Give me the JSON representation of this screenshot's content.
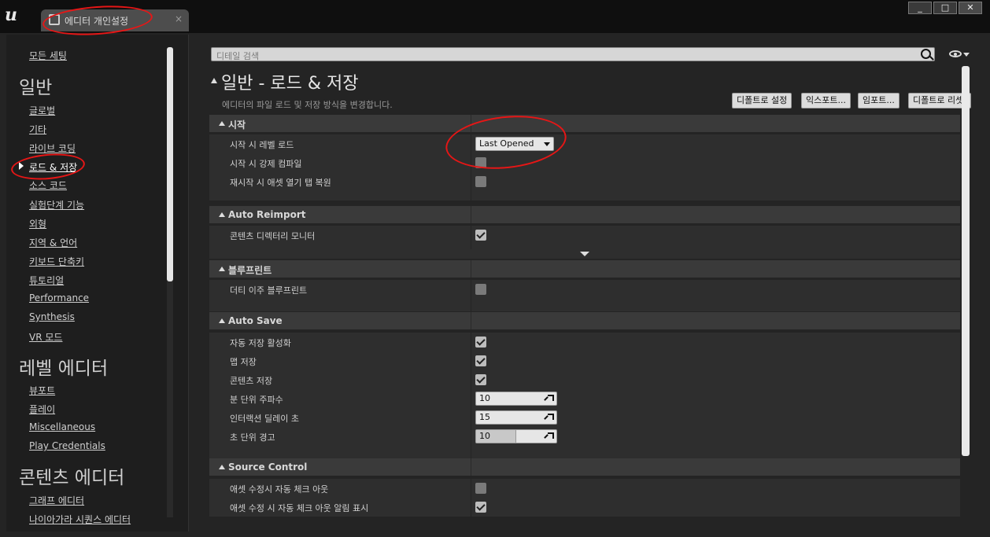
{
  "window": {
    "tab_title": "에디터 개인설정",
    "tab_close": "×",
    "logo": "u",
    "buttons": [
      "_",
      "□",
      "✕"
    ]
  },
  "sidebar": {
    "top_item": "모든 세팅",
    "sections": [
      {
        "title": "일반",
        "items": [
          "글로벌",
          "기타",
          "라이브 코딩",
          "로드 & 저장",
          "소스 코드",
          "실험단계 기능",
          "외형",
          "지역 & 언어",
          "키보드 단축키",
          "튜토리얼",
          "Performance",
          "Synthesis",
          "VR 모드"
        ]
      },
      {
        "title": "레벨 에디터",
        "items": [
          "뷰포트",
          "플레이",
          "Miscellaneous",
          "Play Credentials"
        ]
      },
      {
        "title": "콘텐츠 에디터",
        "items": [
          "그래프 에디터",
          "나이아가라 시퀀스 에디터"
        ]
      }
    ],
    "active_item": "로드 & 저장"
  },
  "search": {
    "placeholder": "디테일 검색"
  },
  "page": {
    "title": "일반 - 로드 & 저장",
    "description": "에디터의 파일 로드 및 저장 방식을 변경합니다.",
    "buttons": [
      "디폴트로 설정",
      "익스포트...",
      "임포트...",
      "디폴트로 리셋"
    ]
  },
  "categories": {
    "startup": {
      "label": "시작",
      "rows": [
        {
          "label": "시작 시 레벨 로드",
          "type": "dropdown",
          "value": "Last Opened"
        },
        {
          "label": "시작 시 강제 컴파일",
          "type": "checkbox",
          "checked": false
        },
        {
          "label": "재시작 시 애셋 열기 탭 복원",
          "type": "checkbox",
          "checked": false
        }
      ]
    },
    "auto_reimport": {
      "label": "Auto Reimport",
      "rows": [
        {
          "label": "콘텐츠 디렉터리 모니터",
          "type": "checkbox",
          "checked": true
        }
      ]
    },
    "blueprint": {
      "label": "블루프린트",
      "rows": [
        {
          "label": "더티 이주 블루프린트",
          "type": "checkbox",
          "checked": false
        }
      ]
    },
    "auto_save": {
      "label": "Auto Save",
      "rows": [
        {
          "label": "자동 저장 활성화",
          "type": "checkbox",
          "checked": true
        },
        {
          "label": "맵 저장",
          "type": "checkbox",
          "checked": true
        },
        {
          "label": "콘텐츠 저장",
          "type": "checkbox",
          "checked": true
        },
        {
          "label": "분 단위 주파수",
          "type": "number",
          "value": "10"
        },
        {
          "label": "인터랙션 딜레이 초",
          "type": "number",
          "value": "15"
        },
        {
          "label": "초 단위 경고",
          "type": "number",
          "value": "10",
          "fill": 0.5
        }
      ]
    },
    "source_control": {
      "label": "Source Control",
      "rows": [
        {
          "label": "애셋 수정시 자동 체크 아웃",
          "type": "checkbox",
          "checked": false
        },
        {
          "label": "애셋 수정 시 자동 체크 아웃 알림 표시",
          "type": "checkbox",
          "checked": true
        }
      ]
    }
  },
  "colors": {
    "annotation": "#e61616",
    "panel": "#242424",
    "category": "#3a3a3a",
    "row": "#2e2e2e"
  }
}
